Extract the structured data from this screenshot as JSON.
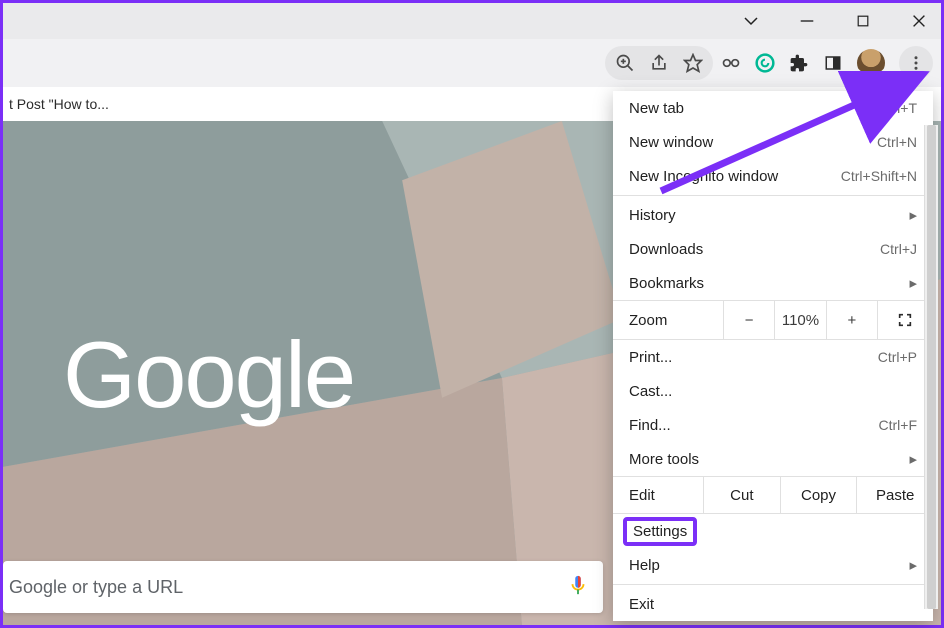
{
  "window": {
    "title": ""
  },
  "bookmark_bar": {
    "text": "t Post \"How to..."
  },
  "omnibox": {
    "placeholder": "Google or type a URL"
  },
  "page": {
    "logo": "Google"
  },
  "toolbar": {
    "extensions": [
      "password-ext",
      "grammarly-ext",
      "extensions",
      "panel-icon"
    ],
    "zoom_ext": "search-icon"
  },
  "menu": {
    "new_tab": {
      "label": "New tab",
      "shortcut": "Ctrl+T"
    },
    "new_window": {
      "label": "New window",
      "shortcut": "Ctrl+N"
    },
    "incognito": {
      "label": "New Incognito window",
      "shortcut": "Ctrl+Shift+N"
    },
    "history": {
      "label": "History"
    },
    "downloads": {
      "label": "Downloads",
      "shortcut": "Ctrl+J"
    },
    "bookmarks": {
      "label": "Bookmarks"
    },
    "zoom": {
      "label": "Zoom",
      "minus": "−",
      "value": "110%",
      "plus": "+"
    },
    "print": {
      "label": "Print...",
      "shortcut": "Ctrl+P"
    },
    "cast": {
      "label": "Cast..."
    },
    "find": {
      "label": "Find...",
      "shortcut": "Ctrl+F"
    },
    "more_tools": {
      "label": "More tools"
    },
    "edit": {
      "label": "Edit",
      "cut": "Cut",
      "copy": "Copy",
      "paste": "Paste"
    },
    "settings": {
      "label": "Settings"
    },
    "help": {
      "label": "Help"
    },
    "exit": {
      "label": "Exit"
    }
  },
  "colors": {
    "accent": "#7b2ff7",
    "grammarly": "#00b894"
  }
}
